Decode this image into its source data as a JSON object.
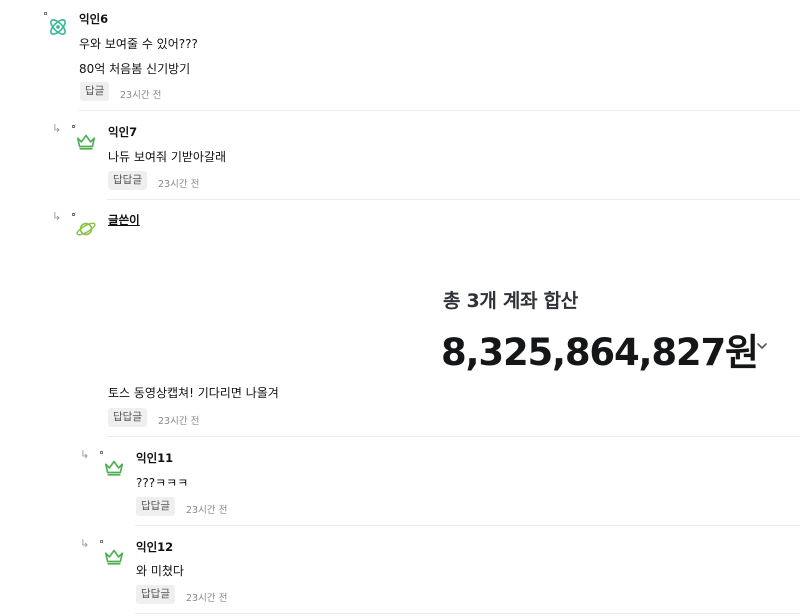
{
  "comments": [
    {
      "nickname": "익인6",
      "lines": [
        "우와 보여줄 수 있어???",
        "80억 처음봄 신기방기"
      ],
      "reply_label": "답글",
      "time": "23시간 전"
    },
    {
      "nickname": "익인7",
      "lines": [
        "나듀 보여줘 기받아갈래"
      ],
      "reply_label": "답답글",
      "time": "23시간 전"
    },
    {
      "nickname": "글쓴이",
      "lines": [
        "토스 동영상캡쳐! 기다리면 나올겨"
      ],
      "reply_label": "답답글",
      "time": "23시간 전"
    },
    {
      "nickname": "익인11",
      "lines": [
        "???ㅋㅋㅋ"
      ],
      "reply_label": "답답글",
      "time": "23시간 전"
    },
    {
      "nickname": "익인12",
      "lines": [
        "와 미쳤다"
      ],
      "reply_label": "답답글",
      "time": "23시간 전"
    }
  ],
  "bank_capture": {
    "title": "총 3개 계좌 합산",
    "amount": "8,325,864,827원",
    "expand_icon": "chevron-down-icon"
  },
  "icons": {
    "reply_arrow": "reply-arrow-icon",
    "avatar_atom": "atom-icon",
    "avatar_crown": "crown-icon",
    "avatar_planet": "planet-icon"
  },
  "colors": {
    "avatar_teal": "#3cb99a",
    "avatar_green": "#4caf50",
    "avatar_lime": "#8bc34a",
    "reply_button_bg": "#efefef",
    "amount_text": "#151617"
  }
}
